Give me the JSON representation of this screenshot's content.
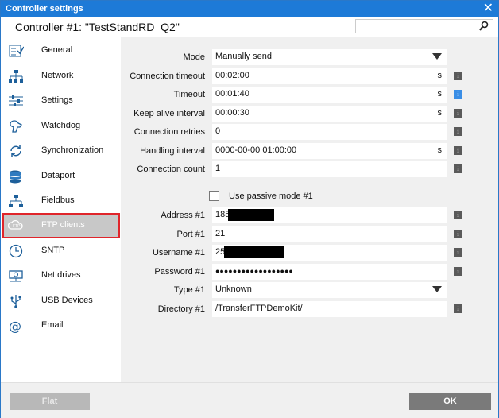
{
  "window": {
    "title": "Controller settings",
    "close_glyph": "✕"
  },
  "header": {
    "controller_title": "Controller #1: \"TestStandRD_Q2\"",
    "search_placeholder": "",
    "search_icon": "search-icon"
  },
  "sidebar": {
    "items": [
      {
        "label": "General",
        "icon": "checklist-icon"
      },
      {
        "label": "Network",
        "icon": "network-icon"
      },
      {
        "label": "Settings",
        "icon": "sliders-icon"
      },
      {
        "label": "Watchdog",
        "icon": "dog-icon"
      },
      {
        "label": "Synchronization",
        "icon": "sync-icon"
      },
      {
        "label": "Dataport",
        "icon": "database-icon"
      },
      {
        "label": "Fieldbus",
        "icon": "fieldbus-icon"
      },
      {
        "label": "FTP clients",
        "icon": "ftp-cloud-icon",
        "selected": true
      },
      {
        "label": "SNTP",
        "icon": "clock-icon"
      },
      {
        "label": "Net drives",
        "icon": "net-drive-icon"
      },
      {
        "label": "USB Devices",
        "icon": "usb-icon"
      },
      {
        "label": "Email",
        "icon": "email-icon"
      }
    ]
  },
  "form": {
    "mode": {
      "label": "Mode",
      "value": "Manually send"
    },
    "connection_timeout": {
      "label": "Connection timeout",
      "value": "00:02:00",
      "unit": "s"
    },
    "timeout": {
      "label": "Timeout",
      "value": "00:01:40",
      "unit": "s"
    },
    "keep_alive": {
      "label": "Keep alive interval",
      "value": "00:00:30",
      "unit": "s"
    },
    "retries": {
      "label": "Connection retries",
      "value": "0"
    },
    "handling_interval": {
      "label": "Handling interval",
      "value": "0000-00-00 01:00:00",
      "unit": "s"
    },
    "connection_count": {
      "label": "Connection count",
      "value": "1"
    },
    "passive_mode": {
      "label": "Use passive mode #1",
      "checked": false
    },
    "address": {
      "label": "Address #1",
      "value": "185"
    },
    "port": {
      "label": "Port #1",
      "value": "21"
    },
    "username": {
      "label": "Username #1",
      "value": "25"
    },
    "password": {
      "label": "Password #1",
      "value": "●●●●●●●●●●●●●●●●●●"
    },
    "type": {
      "label": "Type #1",
      "value": "Unknown"
    },
    "directory": {
      "label": "Directory #1",
      "value": "/TransferFTPDemoKit/"
    },
    "info_glyph": "i"
  },
  "footer": {
    "flat_label": "Flat",
    "ok_label": "OK"
  },
  "colors": {
    "titlebar": "#1d7ad7",
    "selected_outline": "#e0252b",
    "info_blue": "#3a8ee6"
  }
}
